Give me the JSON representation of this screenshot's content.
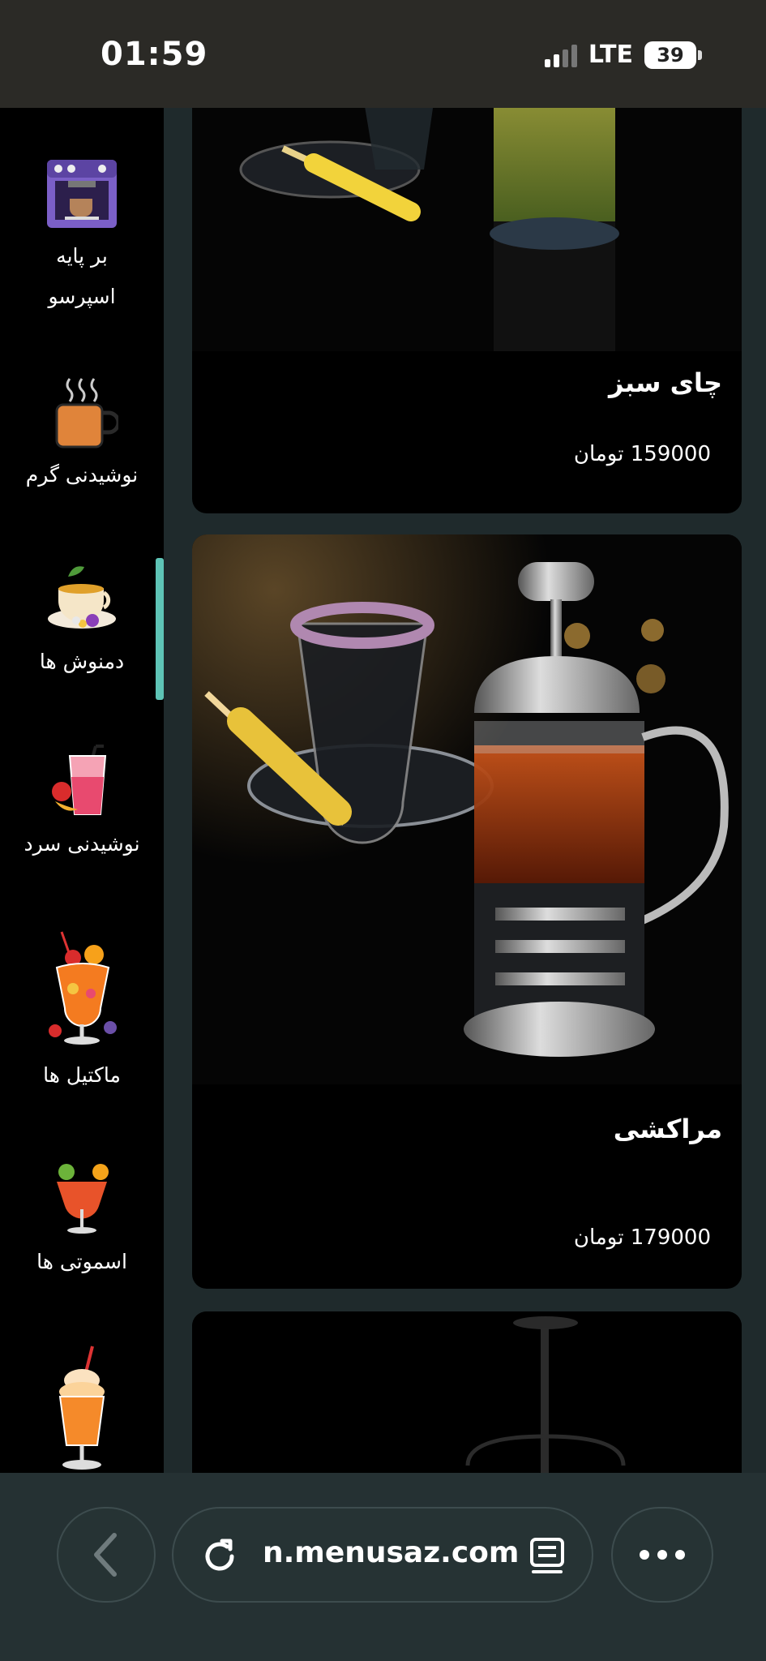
{
  "status": {
    "time": "01:59",
    "network": "LTE",
    "battery": "39"
  },
  "sidebar": {
    "items": [
      {
        "label": "بر پایه اسپرسو",
        "icon": "espresso-machine-icon"
      },
      {
        "label": "نوشیدنی گرم",
        "icon": "hot-cup-icon"
      },
      {
        "label": "دمنوش ها",
        "icon": "herbal-tea-icon"
      },
      {
        "label": "نوشیدنی سرد",
        "icon": "cold-drink-icon"
      },
      {
        "label": "ماکتیل ها",
        "icon": "mocktail-icon"
      },
      {
        "label": "اسموتی ها",
        "icon": "smoothie-icon"
      },
      {
        "label": "",
        "icon": "shake-icon"
      }
    ],
    "active_index": 2,
    "active_color": "#5ec4b6"
  },
  "products": [
    {
      "name": "چای سبز",
      "price": "159000 تومان",
      "image": "green-tea-photo"
    },
    {
      "name": "مراکشی",
      "price": "179000 تومان",
      "image": "moroccan-tea-photo"
    },
    {
      "name": "",
      "price": "",
      "image": "tea-press-photo"
    }
  ],
  "browser": {
    "url": "n.menusaz.com",
    "back_icon": "chevron-left-icon",
    "reload_icon": "reload-icon",
    "reader_icon": "reader-mode-icon",
    "more_icon": "more-dots-icon"
  }
}
